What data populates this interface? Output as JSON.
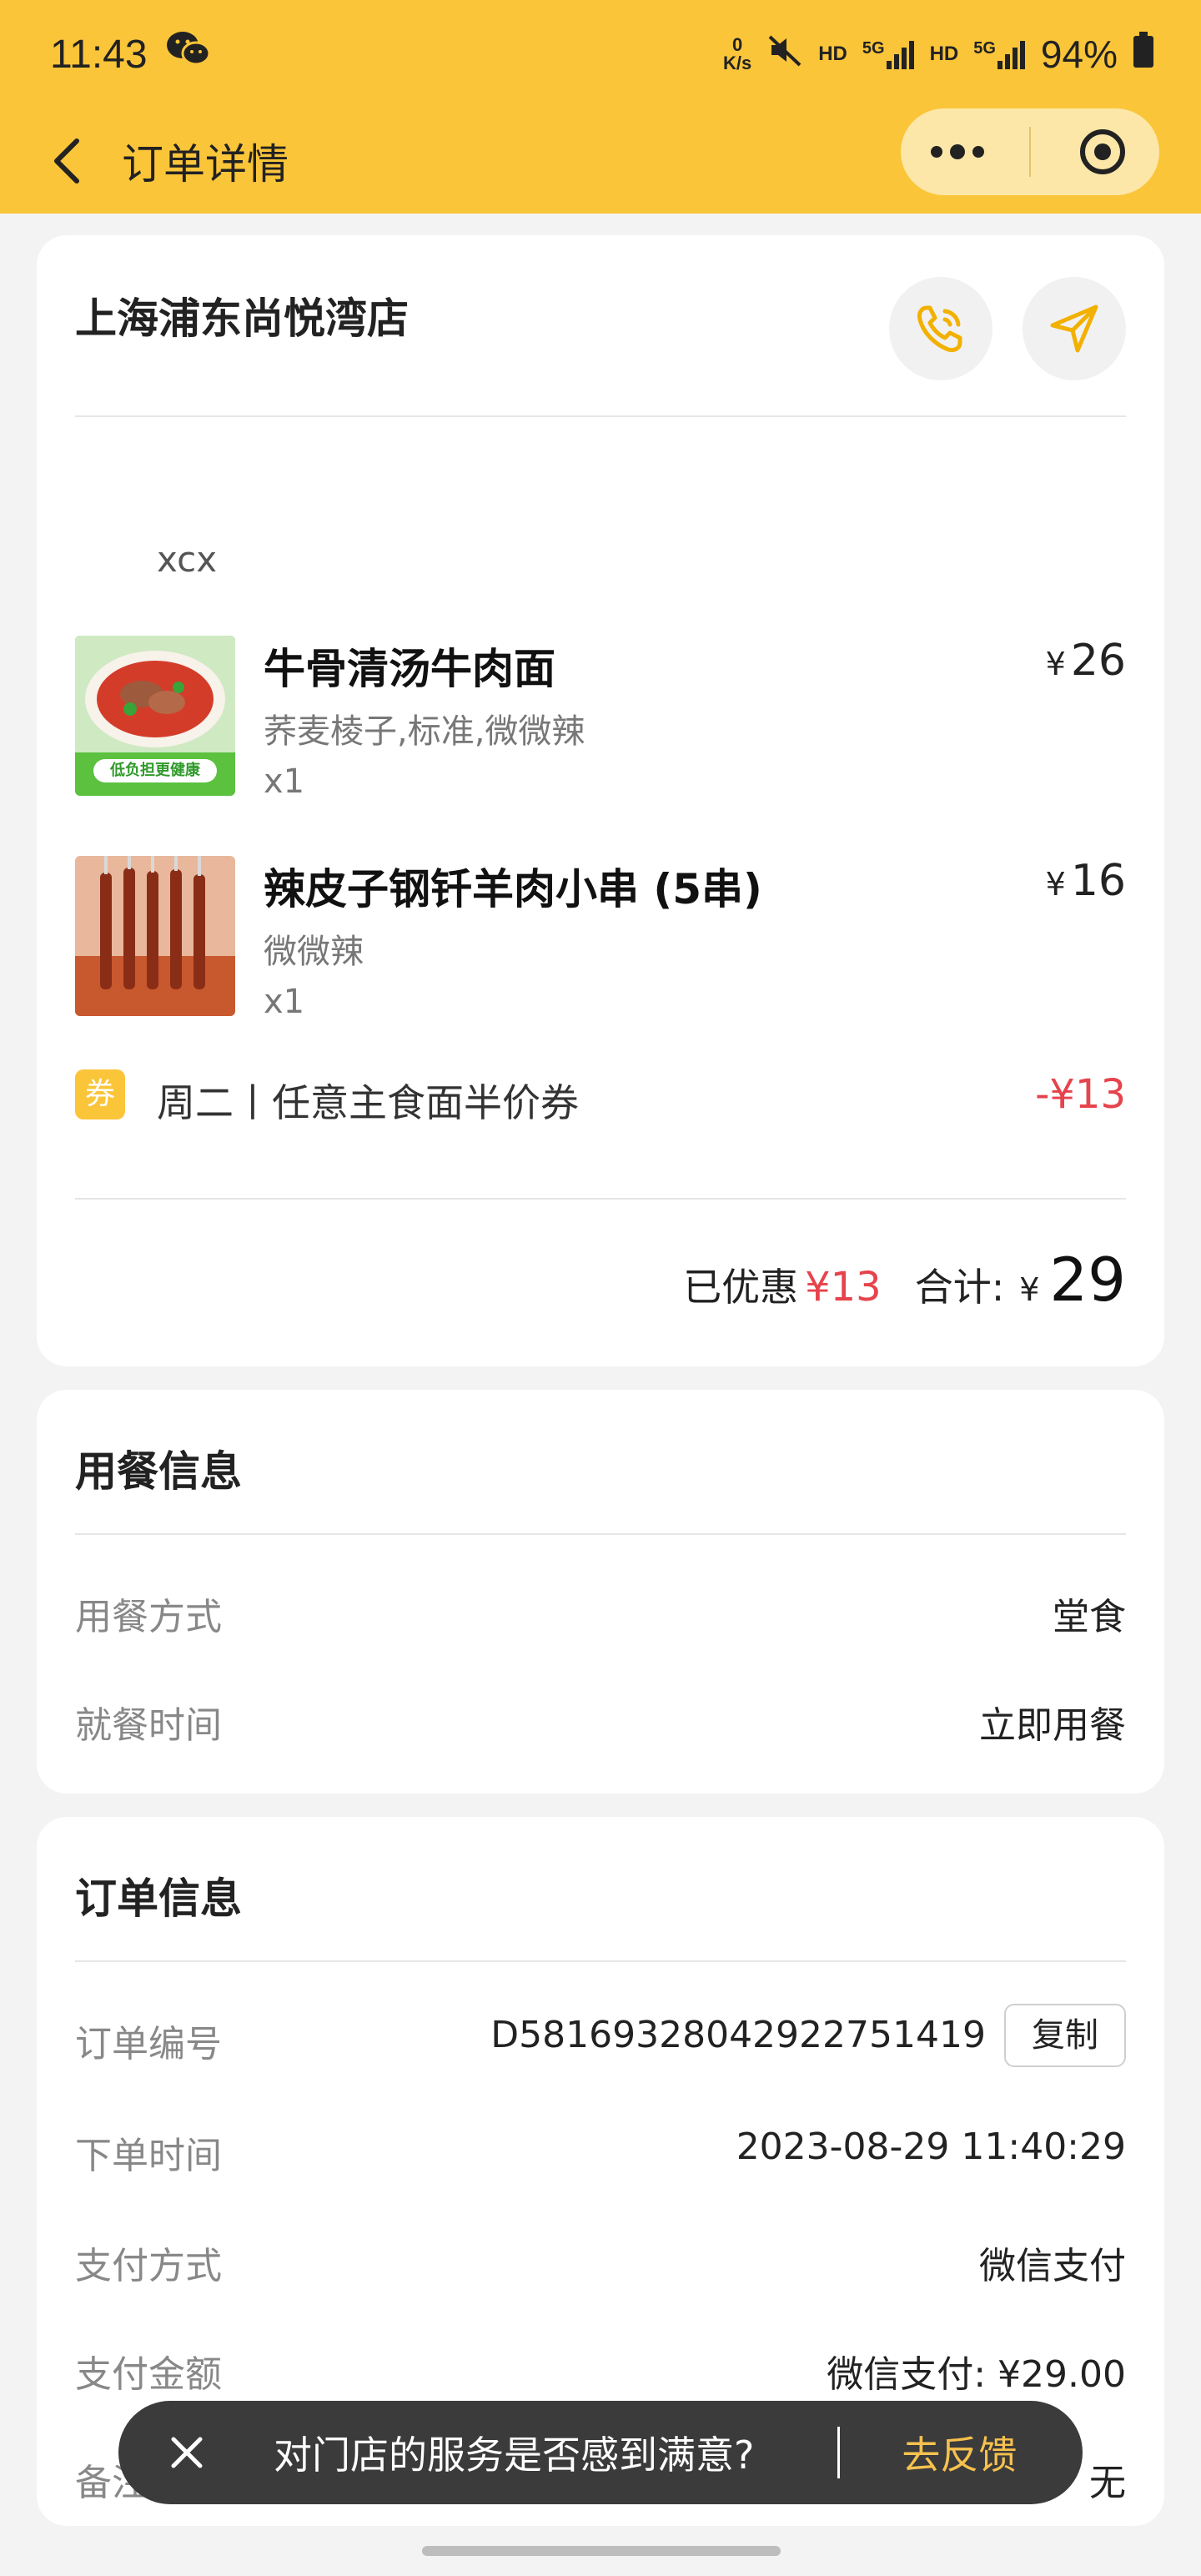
{
  "status_bar": {
    "time": "11:43",
    "net_speed_value": "0",
    "net_speed_unit": "K/s",
    "hd1": "HD",
    "net1": "5G",
    "hd2": "HD",
    "net2": "5G",
    "battery": "94%"
  },
  "nav": {
    "title": "订单详情"
  },
  "order_card": {
    "store_name": "上海浦东尚悦湾店",
    "customer": "xcx",
    "items": [
      {
        "name": "牛骨清汤牛肉面",
        "spec": "荞麦棱子,标准,微微辣",
        "qty": "x1",
        "currency": "¥",
        "price": "26",
        "thumb_caption": "低负担更健康"
      },
      {
        "name": "辣皮子钢钎羊肉小串 (5串)",
        "spec": "微微辣",
        "qty": "x1",
        "currency": "¥",
        "price": "16"
      }
    ],
    "coupon": {
      "badge": "券",
      "text": "周二丨任意主食面半价券",
      "amount": "-¥13"
    },
    "discount_label": "已优惠",
    "discount_value": "¥13",
    "total_label": "合计:",
    "total_currency": "¥",
    "total_value": "29"
  },
  "dining_info": {
    "title": "用餐信息",
    "rows": [
      {
        "label": "用餐方式",
        "value": "堂食"
      },
      {
        "label": "就餐时间",
        "value": "立即用餐"
      }
    ]
  },
  "order_info": {
    "title": "订单信息",
    "order_no_label": "订单编号",
    "order_no": "D58169328042922751419",
    "copy_label": "复制",
    "rows": [
      {
        "label": "下单时间",
        "value": "2023-08-29 11:40:29"
      },
      {
        "label": "支付方式",
        "value": "微信支付"
      },
      {
        "label": "支付金额",
        "value": "微信支付: ¥29.00"
      },
      {
        "label": "备注信息",
        "value": "无"
      }
    ]
  },
  "feedback_toast": {
    "question": "对门店的服务是否感到满意?",
    "action": "去反馈"
  },
  "colors": {
    "brand_yellow": "#fbc53a",
    "discount_red": "#e6434c",
    "toast_bg": "#3b3b3b",
    "toast_action": "#f6c14e"
  }
}
